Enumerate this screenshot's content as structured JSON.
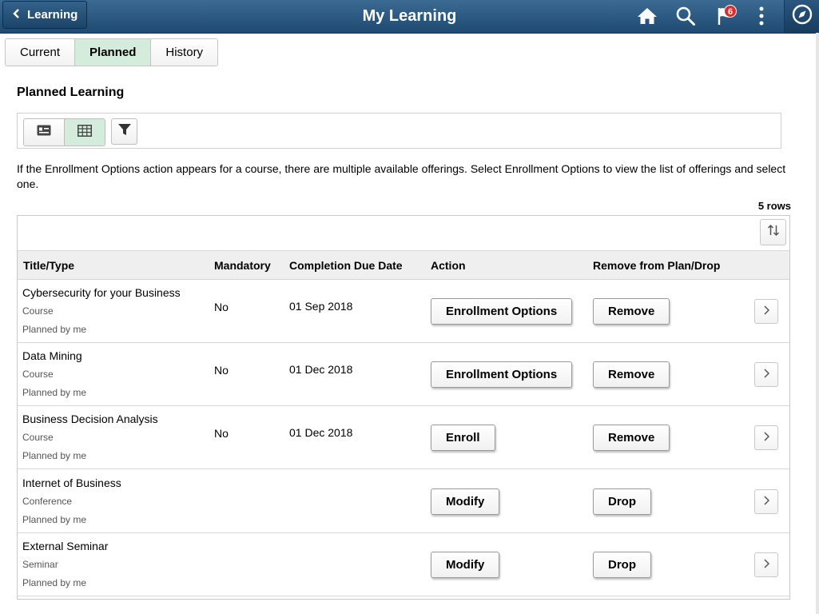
{
  "header": {
    "back_label": "Learning",
    "title": "My Learning",
    "notification_count": "6",
    "icons": [
      "home-icon",
      "search-icon",
      "flag-icon",
      "more-icon",
      "navbar-compass-icon"
    ]
  },
  "tabs": [
    {
      "label": "Current",
      "active": false
    },
    {
      "label": "Planned",
      "active": true
    },
    {
      "label": "History",
      "active": false
    }
  ],
  "section_title": "Planned Learning",
  "toolbar": {
    "icons": [
      "list-view-icon",
      "grid-view-icon",
      "filter-icon"
    ],
    "active_view": "grid"
  },
  "instructions": "If the Enrollment Options action appears for a course, there are multiple available offerings. Select Enrollment Options to view the list of offerings and select one.",
  "grid": {
    "row_count": "5 rows",
    "columns": [
      "Title/Type",
      "Mandatory",
      "Completion Due Date",
      "Action",
      "Remove from Plan/Drop"
    ],
    "rows": [
      {
        "title": "Cybersecurity for your Business",
        "type": "Course",
        "planned": "Planned by me",
        "mandatory": "No",
        "due": "01 Sep 2018",
        "action": "Enrollment Options",
        "remove": "Remove"
      },
      {
        "title": "Data Mining",
        "type": "Course",
        "planned": "Planned by me",
        "mandatory": "No",
        "due": "01 Dec 2018",
        "action": "Enrollment Options",
        "remove": "Remove"
      },
      {
        "title": "Business Decision Analysis",
        "type": "Course",
        "planned": "Planned by me",
        "mandatory": "No",
        "due": "01 Dec 2018",
        "action": "Enroll",
        "remove": "Remove"
      },
      {
        "title": "Internet of Business",
        "type": "Conference",
        "planned": "Planned by me",
        "mandatory": "",
        "due": "",
        "action": "Modify",
        "remove": "Drop"
      },
      {
        "title": "External Seminar",
        "type": "Seminar",
        "planned": "Planned by me",
        "mandatory": "",
        "due": "",
        "action": "Modify",
        "remove": "Drop"
      }
    ]
  },
  "colors": {
    "banner": "#2b5a83",
    "active_tab": "#d4ecdc",
    "badge": "#e02b2b"
  }
}
